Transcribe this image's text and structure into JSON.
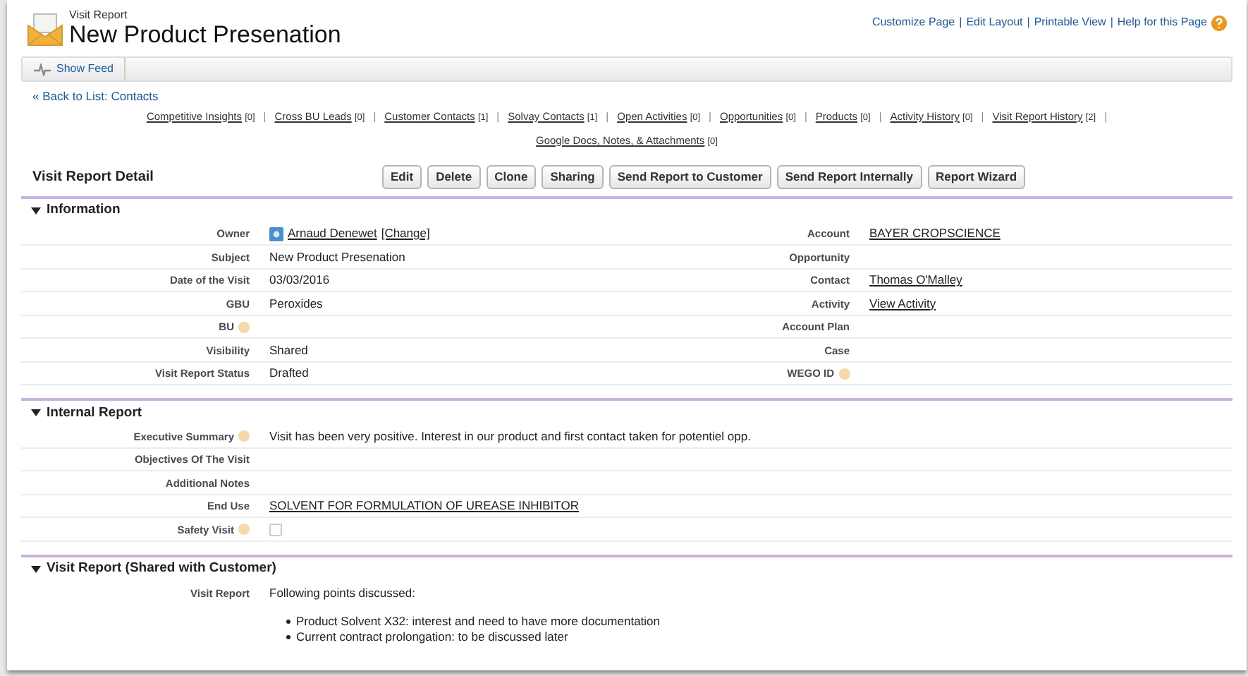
{
  "header": {
    "object_type": "Visit Report",
    "title": "New Product Presenation"
  },
  "top_links": [
    {
      "label": "Customize Page"
    },
    {
      "label": "Edit Layout"
    },
    {
      "label": "Printable View"
    },
    {
      "label": "Help for this Page"
    }
  ],
  "top_links_separator": "|",
  "feed_button": "Show Feed",
  "back_link": "« Back to List: Contacts",
  "related_links_separator": "|",
  "related_links": [
    {
      "label": "Competitive Insights",
      "count": "[0]"
    },
    {
      "label": "Cross BU Leads",
      "count": "[0]"
    },
    {
      "label": "Customer Contacts",
      "count": "[1]"
    },
    {
      "label": "Solvay Contacts",
      "count": "[1]"
    },
    {
      "label": "Open Activities",
      "count": "[0]"
    },
    {
      "label": "Opportunities",
      "count": "[0]"
    },
    {
      "label": "Products",
      "count": "[0]"
    },
    {
      "label": "Activity History",
      "count": "[0]"
    },
    {
      "label": "Visit Report History",
      "count": "[2]"
    },
    {
      "label": "Google Docs, Notes, & Attachments",
      "count": "[0]"
    }
  ],
  "detail": {
    "title": "Visit Report Detail",
    "buttons": [
      "Edit",
      "Delete",
      "Clone",
      "Sharing",
      "Send Report to Customer",
      "Send Report Internally",
      "Report Wizard"
    ]
  },
  "sections": [
    {
      "title": "Information",
      "expanded": true,
      "columns": [
        [
          {
            "label": "Owner",
            "help": false,
            "kind": "owner",
            "value": "Arnaud Denewet",
            "action": "[Change]"
          },
          {
            "label": "Subject",
            "help": false,
            "kind": "text",
            "value": "New Product Presenation"
          },
          {
            "label": "Date of the Visit",
            "help": false,
            "kind": "text",
            "value": "03/03/2016"
          },
          {
            "label": "GBU",
            "help": false,
            "kind": "text",
            "value": "Peroxides"
          },
          {
            "label": "BU",
            "help": true,
            "kind": "text"
          },
          {
            "label": "Visibility",
            "help": false,
            "kind": "text",
            "value": "Shared"
          },
          {
            "label": "Visit Report Status",
            "help": false,
            "kind": "text",
            "value": "Drafted"
          }
        ],
        [
          {
            "label": "Account",
            "help": false,
            "kind": "link",
            "value": "BAYER CROPSCIENCE"
          },
          {
            "label": "Opportunity",
            "help": false,
            "kind": "text"
          },
          {
            "label": "Contact",
            "help": false,
            "kind": "link",
            "value": "Thomas O'Malley"
          },
          {
            "label": "Activity",
            "help": false,
            "kind": "link",
            "value": "View Activity"
          },
          {
            "label": "Account Plan",
            "help": false,
            "kind": "text"
          },
          {
            "label": "Case",
            "help": false,
            "kind": "text"
          },
          {
            "label": "WEGO ID",
            "help": true,
            "kind": "text"
          }
        ]
      ]
    },
    {
      "title": "Internal Report",
      "expanded": true,
      "columns": [
        [
          {
            "label": "Executive Summary",
            "help": true,
            "kind": "text",
            "value": "Visit has been very positive. Interest in our product and first contact taken for potentiel opp."
          },
          {
            "label": "Objectives Of The Visit",
            "help": false,
            "kind": "text"
          },
          {
            "label": "Additional Notes",
            "help": false,
            "kind": "text"
          },
          {
            "label": "End Use",
            "help": false,
            "kind": "link",
            "value": "SOLVENT FOR FORMULATION OF UREASE INHIBITOR"
          },
          {
            "label": "Safety Visit",
            "help": true,
            "kind": "checkbox",
            "checked": false
          }
        ]
      ]
    },
    {
      "title": "Visit Report (Shared with Customer)",
      "expanded": true,
      "columns": [
        [
          {
            "label": "Visit Report",
            "help": false,
            "kind": "bullets",
            "value": "Following points discussed:",
            "items": [
              "Product Solvent X32: interest and need to have more documentation",
              "Current contract prolongation: to be discussed later"
            ]
          }
        ]
      ]
    }
  ]
}
